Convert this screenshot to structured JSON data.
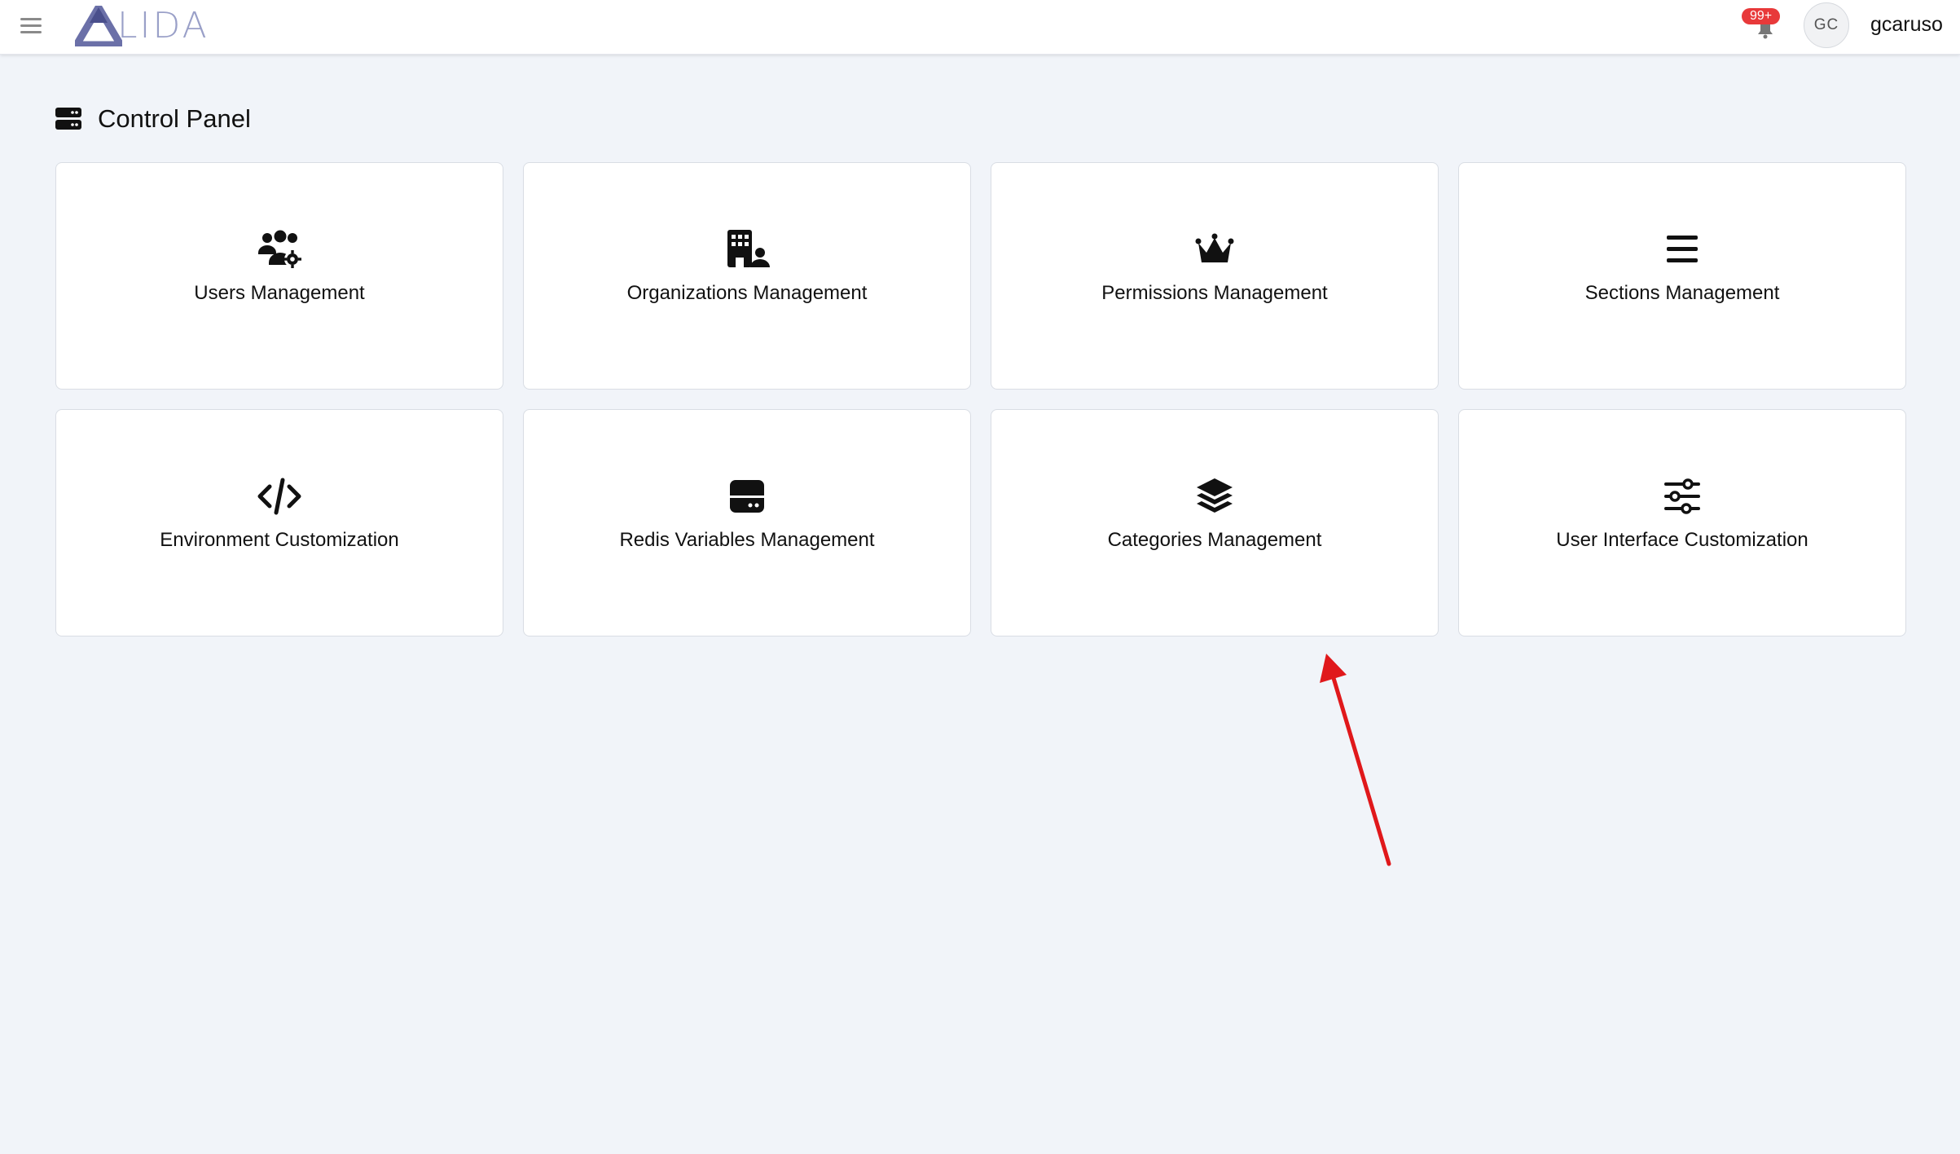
{
  "header": {
    "logo_text": "LIDA",
    "notification_badge": "99+",
    "avatar_initials": "GC",
    "username": "gcaruso"
  },
  "page": {
    "title": "Control Panel"
  },
  "cards": [
    {
      "label": "Users Management",
      "icon": "users-cog-icon"
    },
    {
      "label": "Organizations Management",
      "icon": "building-user-icon"
    },
    {
      "label": "Permissions Management",
      "icon": "crown-icon"
    },
    {
      "label": "Sections Management",
      "icon": "bars-icon"
    },
    {
      "label": "Environment Customization",
      "icon": "code-icon"
    },
    {
      "label": "Redis Variables Management",
      "icon": "hard-drive-icon"
    },
    {
      "label": "Categories Management",
      "icon": "layer-group-icon"
    },
    {
      "label": "User Interface Customization",
      "icon": "sliders-icon"
    }
  ],
  "colors": {
    "background": "#f1f4f9",
    "badge": "#e8393a",
    "logo": "#6b70a8",
    "annotation_arrow": "#e0181b"
  }
}
